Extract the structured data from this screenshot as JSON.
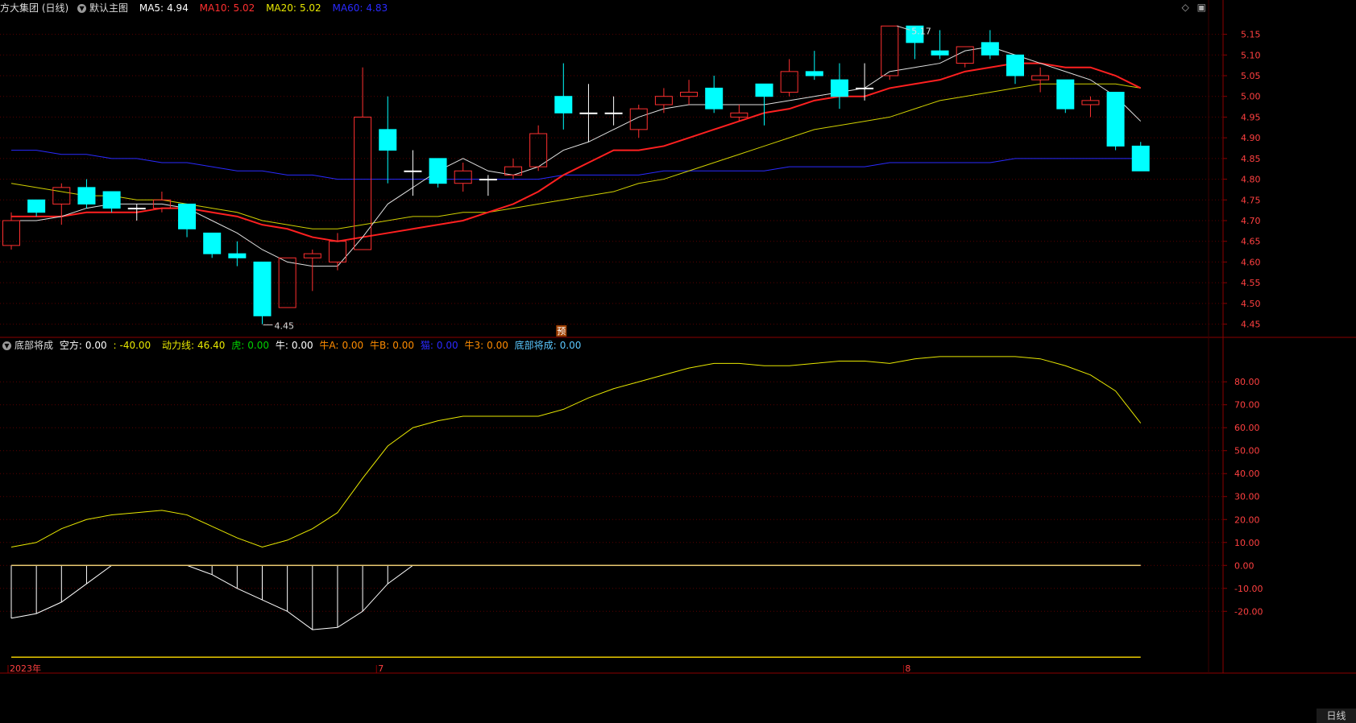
{
  "main": {
    "title": "方大集团 (日线)",
    "toggle_label": "默认主图",
    "ma": [
      {
        "label": "MA5:",
        "value": "4.94",
        "color": "#ffffff"
      },
      {
        "label": "MA10:",
        "value": "5.02",
        "color": "#ff3030"
      },
      {
        "label": "MA20:",
        "value": "5.02",
        "color": "#e8e800"
      },
      {
        "label": "MA60:",
        "value": "4.83",
        "color": "#2a2aff"
      }
    ],
    "high_marker": "5.17",
    "low_marker": "4.45",
    "forecast_badge": "预",
    "price_ticks": [
      "5.15",
      "5.10",
      "5.05",
      "5.00",
      "4.95",
      "4.90",
      "4.85",
      "4.80",
      "4.75",
      "4.70",
      "4.65",
      "4.60",
      "4.55",
      "4.50",
      "4.45"
    ]
  },
  "sub": {
    "title": "底部将成",
    "items": [
      {
        "label": "空方:",
        "value": "0.00",
        "color": "#ffffff"
      },
      {
        "label": ":",
        "value": "-40.00",
        "color": "#e8e800"
      },
      {
        "label": "动力线:",
        "value": "46.40",
        "color": "#e8e800"
      },
      {
        "label": "虎:",
        "value": "0.00",
        "color": "#00d000"
      },
      {
        "label": "牛:",
        "value": "0.00",
        "color": "#ffffff"
      },
      {
        "label": "牛A:",
        "value": "0.00",
        "color": "#ff8c00"
      },
      {
        "label": "牛B:",
        "value": "0.00",
        "color": "#ff8c00"
      },
      {
        "label": "猫:",
        "value": "0.00",
        "color": "#2a2aff"
      },
      {
        "label": "牛3:",
        "value": "0.00",
        "color": "#ff8c00"
      },
      {
        "label": "底部将成:",
        "value": "0.00",
        "color": "#5bc8ff"
      }
    ],
    "ticks": [
      "80.00",
      "70.00",
      "60.00",
      "50.00",
      "40.00",
      "30.00",
      "20.00",
      "10.00",
      "0.00",
      "-10.00",
      "-20.00"
    ]
  },
  "xaxis": {
    "labels": [
      "2023年",
      "7",
      "8"
    ]
  },
  "footer": {
    "period": "日线"
  },
  "colors": {
    "up": "#ff3030",
    "down": "#00ffff",
    "grid": "#5a0000",
    "axis": "#8b0000",
    "tick": "#ff4040"
  },
  "chart_data": [
    {
      "type": "candlestick",
      "ylim": [
        4.42,
        5.19
      ],
      "candles": [
        {
          "o": 4.64,
          "c": 4.7,
          "h": 4.72,
          "l": 4.63
        },
        {
          "o": 4.75,
          "c": 4.72,
          "h": 4.75,
          "l": 4.71
        },
        {
          "o": 4.74,
          "c": 4.78,
          "h": 4.79,
          "l": 4.69
        },
        {
          "o": 4.78,
          "c": 4.74,
          "h": 4.8,
          "l": 4.73
        },
        {
          "o": 4.77,
          "c": 4.73,
          "h": 4.77,
          "l": 4.72
        },
        {
          "o": 4.73,
          "c": 4.73,
          "h": 4.74,
          "l": 4.7
        },
        {
          "o": 4.73,
          "c": 4.75,
          "h": 4.77,
          "l": 4.72
        },
        {
          "o": 4.74,
          "c": 4.68,
          "h": 4.74,
          "l": 4.66
        },
        {
          "o": 4.67,
          "c": 4.62,
          "h": 4.67,
          "l": 4.61
        },
        {
          "o": 4.62,
          "c": 4.61,
          "h": 4.65,
          "l": 4.59
        },
        {
          "o": 4.6,
          "c": 4.47,
          "h": 4.6,
          "l": 4.45
        },
        {
          "o": 4.49,
          "c": 4.61,
          "h": 4.61,
          "l": 4.49
        },
        {
          "o": 4.61,
          "c": 4.62,
          "h": 4.63,
          "l": 4.53
        },
        {
          "o": 4.6,
          "c": 4.65,
          "h": 4.67,
          "l": 4.58
        },
        {
          "o": 4.63,
          "c": 4.95,
          "h": 5.07,
          "l": 4.63
        },
        {
          "o": 4.92,
          "c": 4.87,
          "h": 5.0,
          "l": 4.79
        },
        {
          "o": 4.82,
          "c": 4.82,
          "h": 4.87,
          "l": 4.76
        },
        {
          "o": 4.85,
          "c": 4.79,
          "h": 4.85,
          "l": 4.78
        },
        {
          "o": 4.79,
          "c": 4.82,
          "h": 4.84,
          "l": 4.77
        },
        {
          "o": 4.8,
          "c": 4.8,
          "h": 4.81,
          "l": 4.76
        },
        {
          "o": 4.81,
          "c": 4.83,
          "h": 4.85,
          "l": 4.8
        },
        {
          "o": 4.83,
          "c": 4.91,
          "h": 4.93,
          "l": 4.82
        },
        {
          "o": 5.0,
          "c": 4.96,
          "h": 5.08,
          "l": 4.92
        },
        {
          "o": 4.96,
          "c": 4.96,
          "h": 5.03,
          "l": 4.89
        },
        {
          "o": 4.96,
          "c": 4.96,
          "h": 5.0,
          "l": 4.93
        },
        {
          "o": 4.92,
          "c": 4.97,
          "h": 4.98,
          "l": 4.9
        },
        {
          "o": 4.98,
          "c": 5.0,
          "h": 5.02,
          "l": 4.96
        },
        {
          "o": 5.0,
          "c": 5.01,
          "h": 5.04,
          "l": 4.98
        },
        {
          "o": 5.02,
          "c": 4.97,
          "h": 5.05,
          "l": 4.96
        },
        {
          "o": 4.95,
          "c": 4.96,
          "h": 4.98,
          "l": 4.94
        },
        {
          "o": 5.03,
          "c": 5.0,
          "h": 5.03,
          "l": 4.93
        },
        {
          "o": 5.01,
          "c": 5.06,
          "h": 5.09,
          "l": 5.0
        },
        {
          "o": 5.06,
          "c": 5.05,
          "h": 5.11,
          "l": 5.04
        },
        {
          "o": 5.04,
          "c": 5.0,
          "h": 5.08,
          "l": 4.97
        },
        {
          "o": 5.02,
          "c": 5.02,
          "h": 5.08,
          "l": 4.99
        },
        {
          "o": 5.05,
          "c": 5.17,
          "h": 5.17,
          "l": 5.04
        },
        {
          "o": 5.17,
          "c": 5.13,
          "h": 5.17,
          "l": 5.09
        },
        {
          "o": 5.11,
          "c": 5.1,
          "h": 5.16,
          "l": 5.09
        },
        {
          "o": 5.08,
          "c": 5.12,
          "h": 5.12,
          "l": 5.07
        },
        {
          "o": 5.13,
          "c": 5.1,
          "h": 5.16,
          "l": 5.09
        },
        {
          "o": 5.1,
          "c": 5.05,
          "h": 5.1,
          "l": 5.03
        },
        {
          "o": 5.04,
          "c": 5.05,
          "h": 5.07,
          "l": 5.01
        },
        {
          "o": 5.04,
          "c": 4.97,
          "h": 5.04,
          "l": 4.96
        },
        {
          "o": 4.98,
          "c": 4.99,
          "h": 5.0,
          "l": 4.95
        },
        {
          "o": 5.01,
          "c": 4.88,
          "h": 5.01,
          "l": 4.87
        },
        {
          "o": 4.88,
          "c": 4.82,
          "h": 4.89,
          "l": 4.82
        }
      ],
      "ma5": [
        4.7,
        4.7,
        4.71,
        4.73,
        4.74,
        4.74,
        4.74,
        4.73,
        4.7,
        4.67,
        4.63,
        4.6,
        4.59,
        4.59,
        4.66,
        4.74,
        4.78,
        4.82,
        4.85,
        4.82,
        4.81,
        4.83,
        4.87,
        4.89,
        4.92,
        4.95,
        4.97,
        4.98,
        4.98,
        4.98,
        4.98,
        4.99,
        5.0,
        5.01,
        5.02,
        5.06,
        5.07,
        5.08,
        5.11,
        5.12,
        5.1,
        5.08,
        5.06,
        5.04,
        5.0,
        4.94
      ],
      "ma10": [
        4.71,
        4.71,
        4.71,
        4.72,
        4.72,
        4.72,
        4.73,
        4.73,
        4.72,
        4.71,
        4.69,
        4.68,
        4.66,
        4.65,
        4.66,
        4.67,
        4.68,
        4.69,
        4.7,
        4.72,
        4.74,
        4.77,
        4.81,
        4.84,
        4.87,
        4.87,
        4.88,
        4.9,
        4.92,
        4.94,
        4.96,
        4.97,
        4.99,
        5.0,
        5.0,
        5.02,
        5.03,
        5.04,
        5.06,
        5.07,
        5.08,
        5.08,
        5.07,
        5.07,
        5.05,
        5.02
      ],
      "ma20": [
        4.79,
        4.78,
        4.77,
        4.76,
        4.76,
        4.75,
        4.75,
        4.74,
        4.73,
        4.72,
        4.7,
        4.69,
        4.68,
        4.68,
        4.69,
        4.7,
        4.71,
        4.71,
        4.72,
        4.72,
        4.73,
        4.74,
        4.75,
        4.76,
        4.77,
        4.79,
        4.8,
        4.82,
        4.84,
        4.86,
        4.88,
        4.9,
        4.92,
        4.93,
        4.94,
        4.95,
        4.97,
        4.99,
        5.0,
        5.01,
        5.02,
        5.03,
        5.03,
        5.03,
        5.03,
        5.02
      ],
      "ma60": [
        4.87,
        4.87,
        4.86,
        4.86,
        4.85,
        4.85,
        4.84,
        4.84,
        4.83,
        4.82,
        4.82,
        4.81,
        4.81,
        4.8,
        4.8,
        4.8,
        4.8,
        4.8,
        4.8,
        4.8,
        4.8,
        4.8,
        4.81,
        4.81,
        4.81,
        4.81,
        4.82,
        4.82,
        4.82,
        4.82,
        4.82,
        4.83,
        4.83,
        4.83,
        4.83,
        4.84,
        4.84,
        4.84,
        4.84,
        4.84,
        4.85,
        4.85,
        4.85,
        4.85,
        4.85,
        4.85
      ]
    },
    {
      "type": "line",
      "ylim": [
        -42,
        92
      ],
      "series": [
        {
          "name": "动力线",
          "values": [
            8,
            10,
            16,
            20,
            22,
            23,
            24,
            22,
            17,
            12,
            8,
            11,
            16,
            23,
            38,
            52,
            60,
            63,
            65,
            65,
            65,
            65,
            68,
            73,
            77,
            80,
            83,
            86,
            88,
            88,
            87,
            87,
            88,
            89,
            89,
            88,
            90,
            91,
            91,
            91,
            91,
            90,
            87,
            83,
            76,
            62
          ]
        },
        {
          "name": "空方",
          "values": [
            -23,
            -21,
            -16,
            -8,
            0,
            0,
            0,
            0,
            -4,
            -10,
            -15,
            -20,
            -28,
            -27,
            -20,
            -8,
            0,
            0,
            0,
            0,
            0,
            0,
            0,
            0,
            0,
            0,
            0,
            0,
            0,
            0,
            0,
            0,
            0,
            0,
            0,
            0,
            0,
            0,
            0,
            0,
            0,
            0,
            0,
            0,
            0,
            0
          ]
        },
        {
          "name": ":",
          "values": [
            -40,
            -40,
            -40,
            -40,
            -40,
            -40,
            -40,
            -40,
            -40,
            -40,
            -40,
            -40,
            -40,
            -40,
            -40,
            -40,
            -40,
            -40,
            -40,
            -40,
            -40,
            -40,
            -40,
            -40,
            -40,
            -40,
            -40,
            -40,
            -40,
            -40,
            -40,
            -40,
            -40,
            -40,
            -40,
            -40,
            -40,
            -40,
            -40,
            -40,
            -40,
            -40,
            -40,
            -40,
            -40,
            -40
          ]
        }
      ]
    }
  ]
}
